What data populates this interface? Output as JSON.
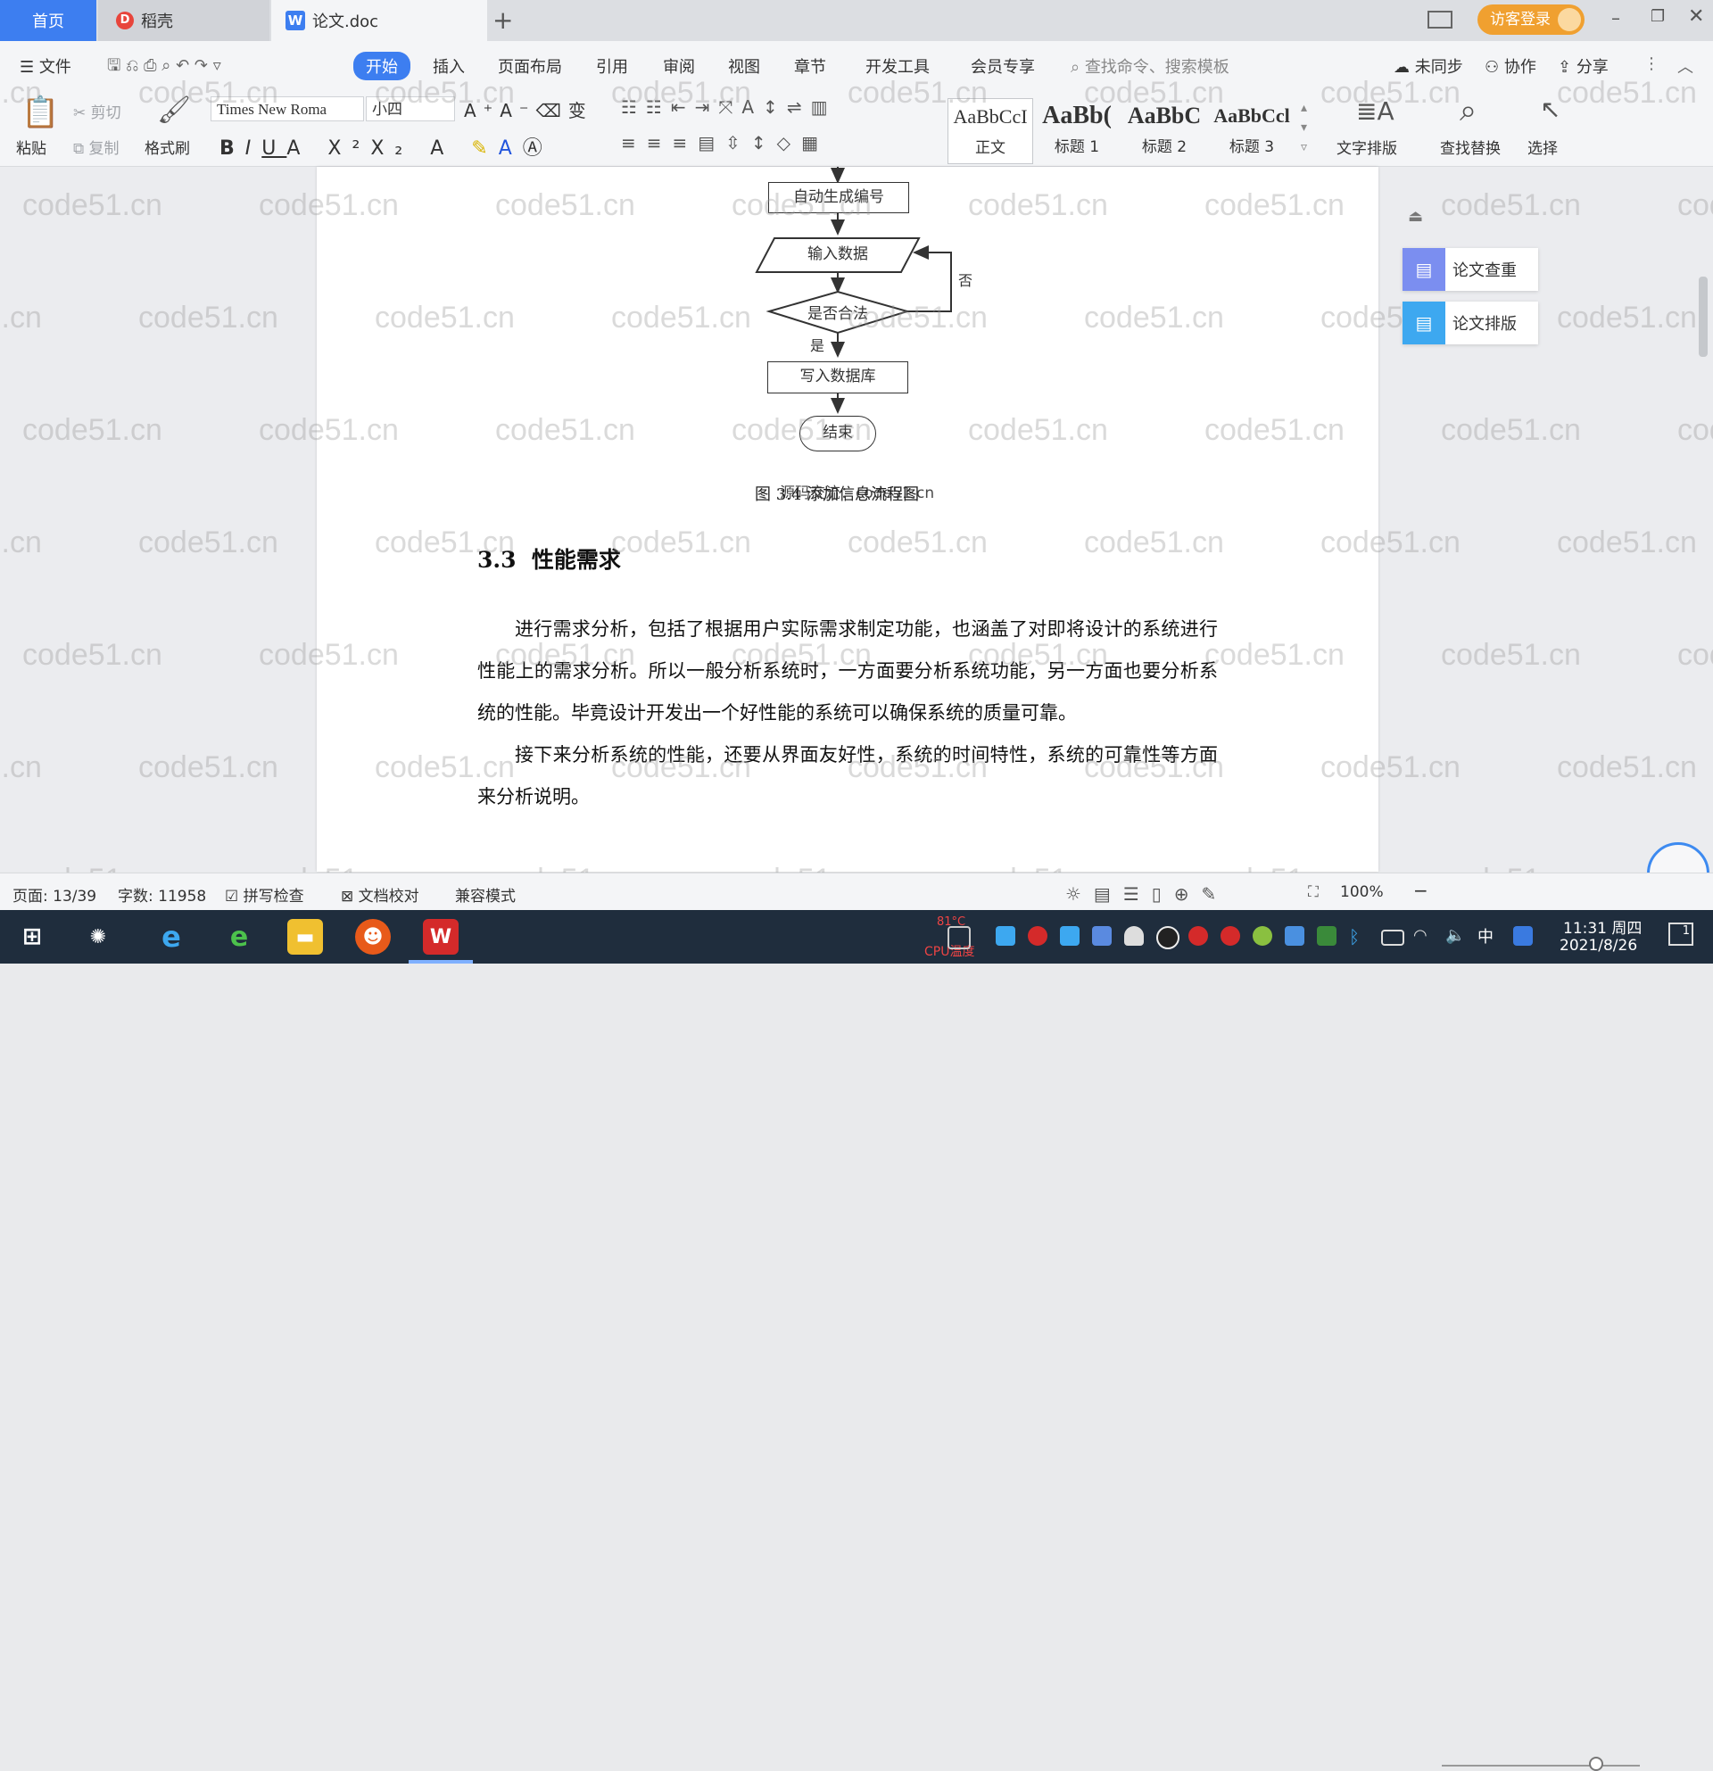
{
  "tabs": {
    "home": "首页",
    "daoke": "稻壳",
    "doc": "论文.doc",
    "add": "+"
  },
  "titlebar": {
    "login": "访客登录"
  },
  "menus": {
    "file": "文件",
    "start": "开始",
    "insert": "插入",
    "layout": "页面布局",
    "reference": "引用",
    "review": "审阅",
    "view": "视图",
    "chapter": "章节",
    "devtools": "开发工具",
    "member": "会员专享",
    "search_placeholder": "查找命令、搜索模板",
    "sync": "未同步",
    "collab": "协作",
    "share": "分享"
  },
  "ribbon": {
    "paste": "粘贴",
    "cut": "剪切",
    "copy": "复制",
    "format_painter": "格式刷",
    "font_name": "Times New Roma",
    "font_size": "小四",
    "text_layout": "文字排版",
    "find_replace": "查找替换",
    "select": "选择"
  },
  "styles": [
    {
      "preview": "AaBbCcI",
      "label": "正文"
    },
    {
      "preview": "AaBb(",
      "label": "标题 1"
    },
    {
      "preview": "AaBbC",
      "label": "标题 2"
    },
    {
      "preview": "AaBbCcl",
      "label": "标题 3"
    }
  ],
  "flowchart": {
    "n1": "自动生成编号",
    "n2": "输入数据",
    "n3": "是否合法",
    "n4": "写入数据库",
    "n5": "结束",
    "yes": "是",
    "no": "否",
    "caption": "图 3.4 添加信息流程图"
  },
  "watermark": "code51.cn",
  "overlay_text": "源码交流：code51.cn",
  "section": {
    "number": "3.3",
    "title": "性能需求"
  },
  "paragraphs": [
    "进行需求分析，包括了根据用户实际需求制定功能，也涵盖了对即将设计的系统进行性能上的需求分析。所以一般分析系统时，一方面要分析系统功能，另一方面也要分析系统的性能。毕竟设计开发出一个好性能的系统可以确保系统的质量可靠。",
    "接下来分析系统的性能，还要从界面友好性，系统的时间特性，系统的可靠性等方面来分析说明。"
  ],
  "right_panel": {
    "check": "论文查重",
    "format": "论文排版"
  },
  "statusbar": {
    "page": "页面: 13/39",
    "words": "字数: 11958",
    "spell": "拼写检查",
    "proof": "文档校对",
    "compat": "兼容模式",
    "zoom": "100%"
  },
  "zoom_level_percent": 100,
  "taskbar": {
    "time": "11:31 周四",
    "date": "2021/8/26",
    "ime": "中",
    "notify_count": "1",
    "temp": "81°C",
    "cpu_label": "CPU温度"
  }
}
